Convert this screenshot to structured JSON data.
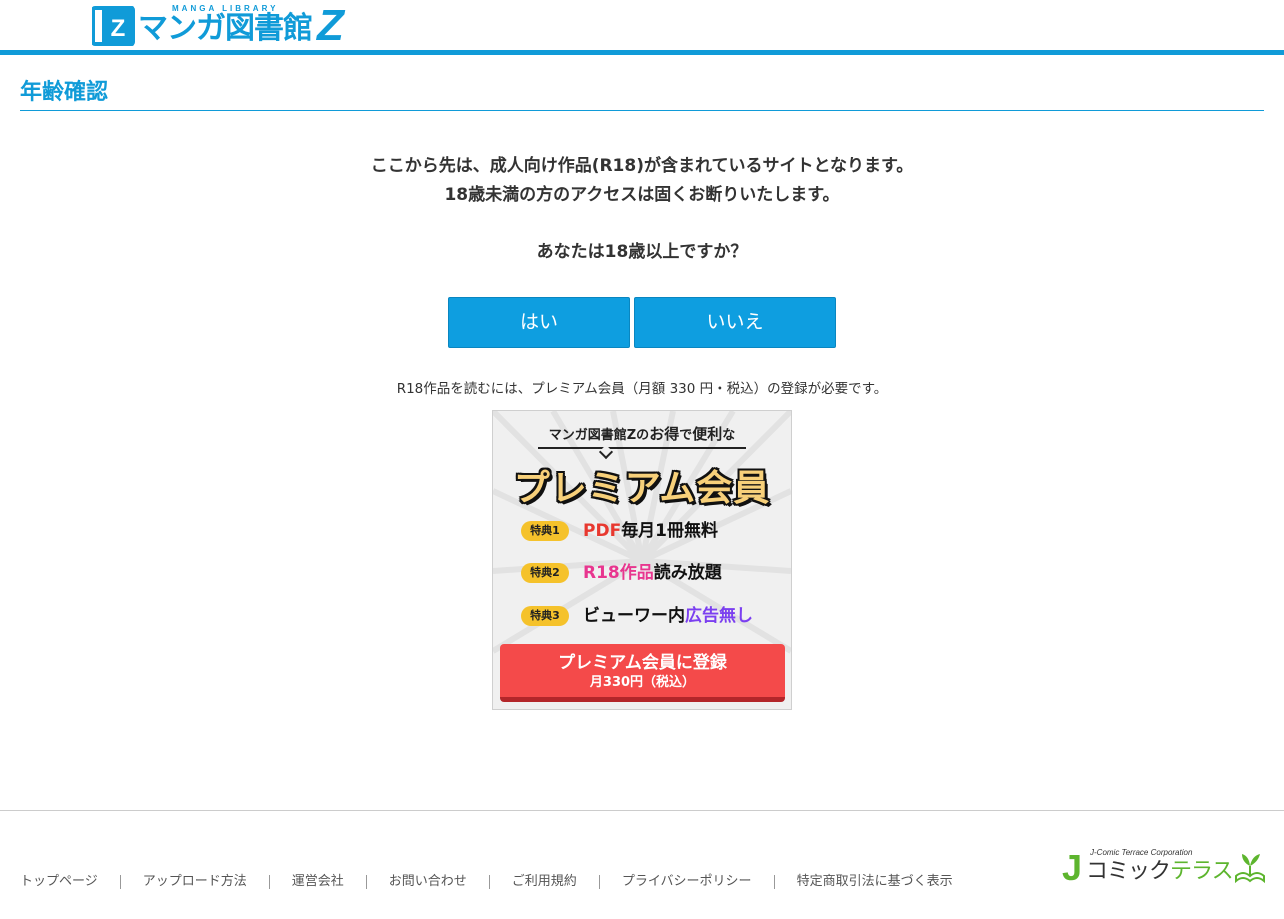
{
  "header": {
    "logo_sub": "MANGA LIBRARY",
    "logo_text": "マンガ図書館",
    "logo_z": "Z",
    "brand_color": "#109bd8"
  },
  "page_title": "年齢確認",
  "message": {
    "line1": "ここから先は、成人向け作品(R18)が含まれているサイトとなります。",
    "line2": "18歳未満の方のアクセスは固くお断りいたします。",
    "question": "あなたは18歳以上ですか？"
  },
  "buttons": {
    "yes": "はい",
    "no": "いいえ",
    "color": "#0e9ee0"
  },
  "note": "R18作品を読むには、プレミアム会員（月額 330 円・税込）の登録が必要です。",
  "banner": {
    "tagline_pre": "マンガ図書館Zの",
    "tagline_em1": "お得",
    "tagline_mid": "で",
    "tagline_em2": "便利",
    "tagline_post": "な",
    "title": "プレミアム会員",
    "benefits": [
      {
        "badge": "特典1",
        "highlight": "PDF",
        "text": "毎月1冊無料"
      },
      {
        "badge": "特典2",
        "highlight": "R18作品",
        "text": "読み放題"
      },
      {
        "badge": "特典3",
        "text": "ビューワー内",
        "highlight": "広告無し"
      }
    ],
    "cta_main": "プレミアム会員に登録",
    "cta_sub": "月330円（税込）"
  },
  "footer": {
    "links": [
      "トップページ",
      "アップロード方法",
      "運営会社",
      "お問い合わせ",
      "ご利用規約",
      "プライバシーポリシー",
      "特定商取引法に基づく表示"
    ],
    "partner_corp": "J-Comic Terrace Corporation",
    "partner_j": "J",
    "partner_name_a": "コミック",
    "partner_name_b": "テラス"
  }
}
